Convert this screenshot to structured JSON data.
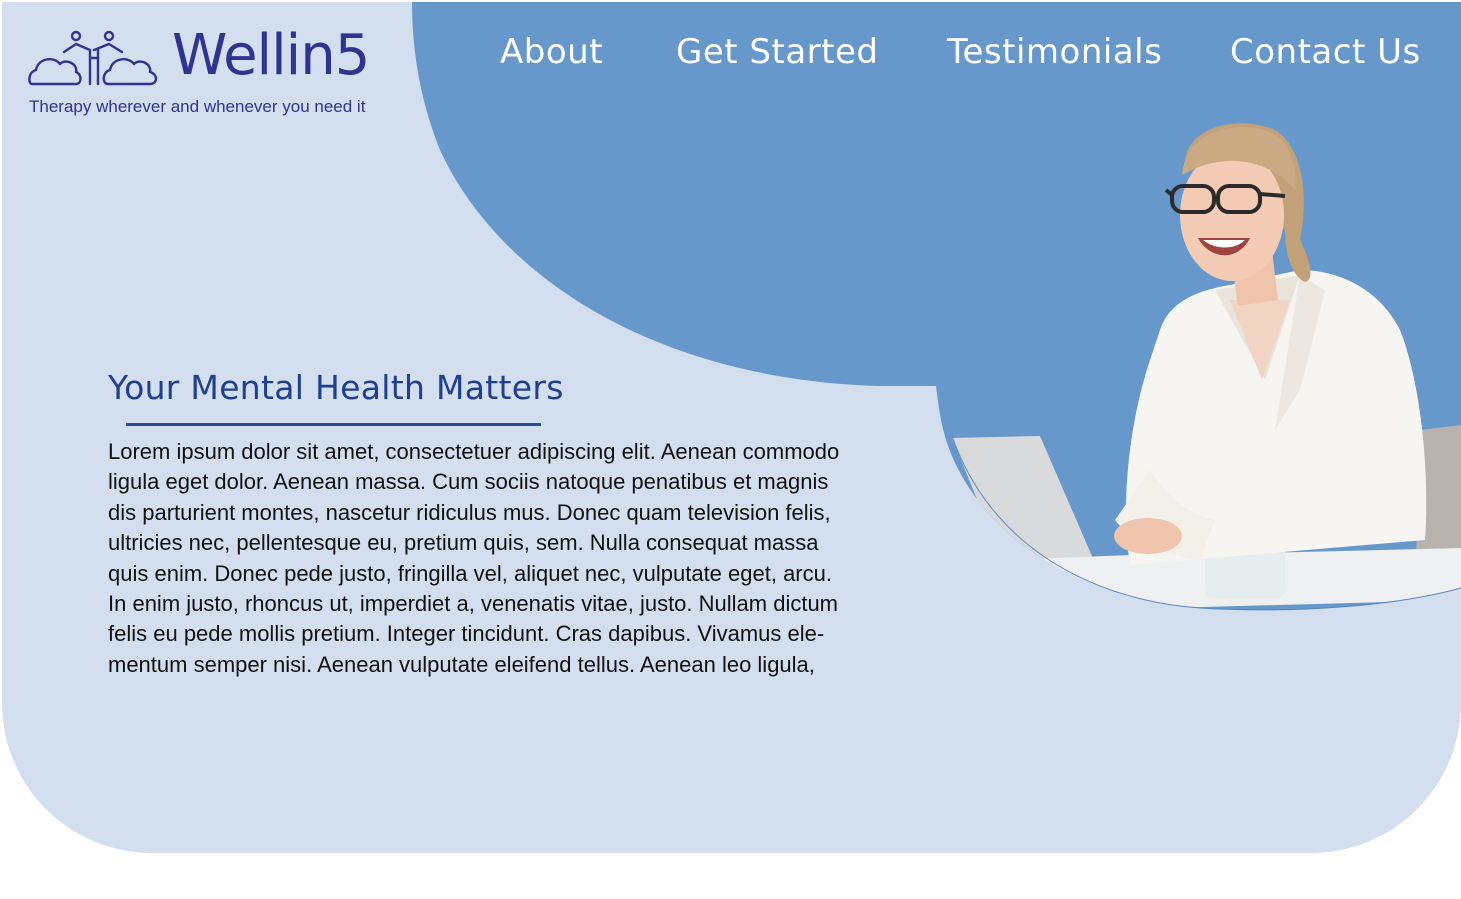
{
  "brand": {
    "name": "Wellin5",
    "tagline": "Therapy wherever and whenever you need it"
  },
  "nav": {
    "items": [
      {
        "label": "About"
      },
      {
        "label": "Get Started"
      },
      {
        "label": "Testimonials"
      },
      {
        "label": "Contact Us"
      }
    ]
  },
  "hero": {
    "title": "Your Mental Health Matters",
    "body_lines": [
      "Lorem ipsum dolor sit amet, consectetuer adipiscing elit. Aenean commodo",
      "ligula eget dolor. Aenean massa. Cum sociis natoque penatibus et magnis",
      "dis parturient montes, nascetur ridiculus mus. Donec quam television felis,",
      "ultricies nec, pellentesque eu, pretium quis, sem. Nulla consequat massa",
      "quis enim. Donec pede justo, fringilla vel, aliquet nec, vulputate eget, arcu.",
      "In enim justo, rhoncus ut, imperdiet a, venenatis vitae, justo. Nullam dictum",
      "felis eu pede mollis pretium. Integer tincidunt. Cras dapibus. Vivamus ele-",
      "mentum semper nisi. Aenean vulputate eleifend tellus. Aenean leo ligula,"
    ]
  },
  "colors": {
    "hero_background": "#d3deef",
    "accent_blue": "#6698cc",
    "brand_indigo": "#2f3392",
    "heading_blue": "#1f3f8f"
  },
  "icons": {
    "logo": "people-on-clouds-icon"
  }
}
